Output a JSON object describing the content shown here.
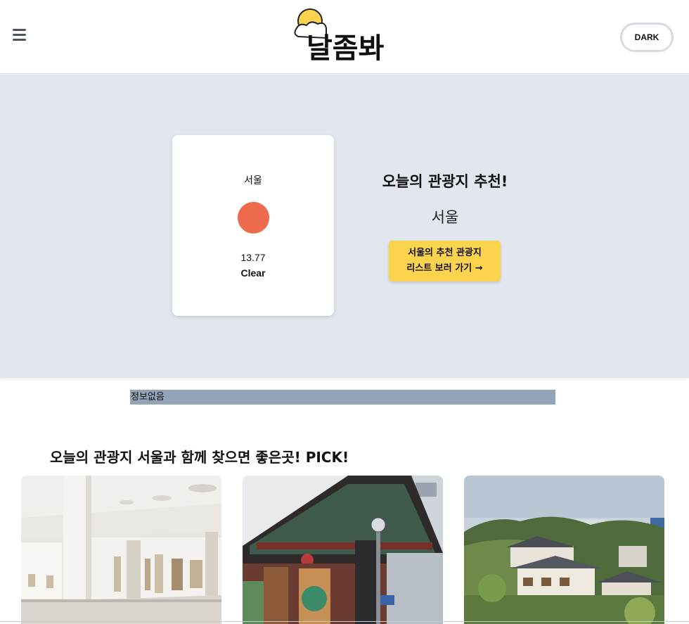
{
  "header": {
    "menu_icon": "hamburger-menu-icon",
    "logo_text": "날좀봐",
    "dark_button_label": "DARK"
  },
  "weather_card": {
    "city": "서울",
    "icon": "sun-icon",
    "icon_color": "#ee6c4d",
    "temperature": "13.77",
    "description": "Clear"
  },
  "recommendation": {
    "title": "오늘의 관광지 추천!",
    "city": "서울",
    "button_line1": "서울의 추천 관광지",
    "button_line2": "리스트 보러 가기 →",
    "button_color": "#fcd34d"
  },
  "info_bar": {
    "text": "정보없음"
  },
  "pick_section": {
    "title": "오늘의 관광지 서울과 함께 찾으면 좋은곳! PICK!",
    "cards": [
      {
        "image": "museum-gallery-photo"
      },
      {
        "image": "traditional-gate-alley-photo"
      },
      {
        "image": "hanok-hillside-village-photo"
      }
    ]
  },
  "colors": {
    "hero_background": "#e2e7ef",
    "info_bar_background": "#93a3b8"
  }
}
